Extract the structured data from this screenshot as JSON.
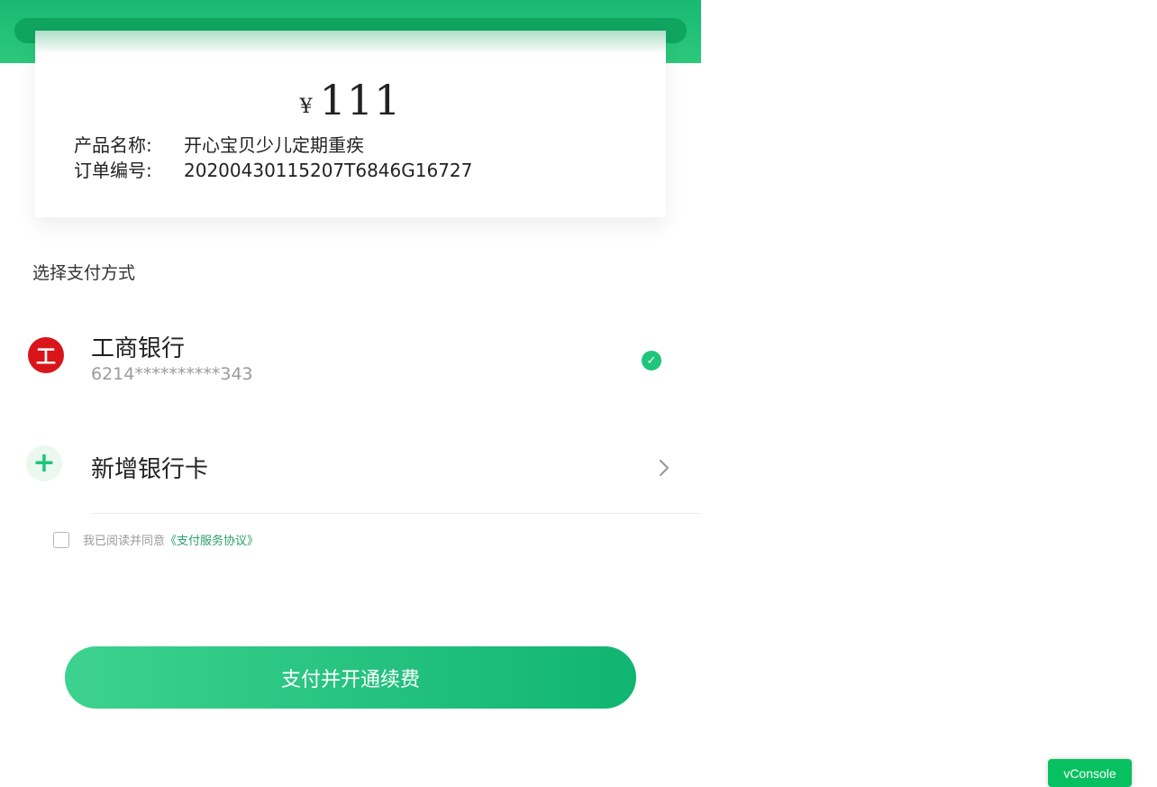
{
  "order": {
    "currency_symbol": "¥",
    "amount": "111",
    "product_label": "产品名称:",
    "product_name": "开心宝贝少儿定期重疾",
    "order_label": "订单编号:",
    "order_number": "20200430115207T6846G16727"
  },
  "payment": {
    "section_title": "选择支付方式",
    "method": {
      "bank_icon": "icbc-logo-icon",
      "bank_logo_glyph": "工",
      "bank_name": "工商银行",
      "card_number": "6214**********343",
      "selected": true,
      "selected_icon": "check-circle-icon"
    },
    "add_card": {
      "icon": "plus-icon",
      "label": "新增银行卡",
      "chevron_icon": "chevron-right-icon"
    }
  },
  "agreement": {
    "checked": false,
    "text": "我已阅读并同意",
    "link_text": "《支付服务协议》"
  },
  "pay_button": {
    "label": "支付并开通续费"
  },
  "vconsole": {
    "label": "vConsole"
  },
  "colors": {
    "brand_green": "#1ec57b",
    "header_green": "#19b874",
    "bank_red": "#d9151b",
    "link_green": "#28a06b",
    "vconsole_green": "#07c160"
  }
}
